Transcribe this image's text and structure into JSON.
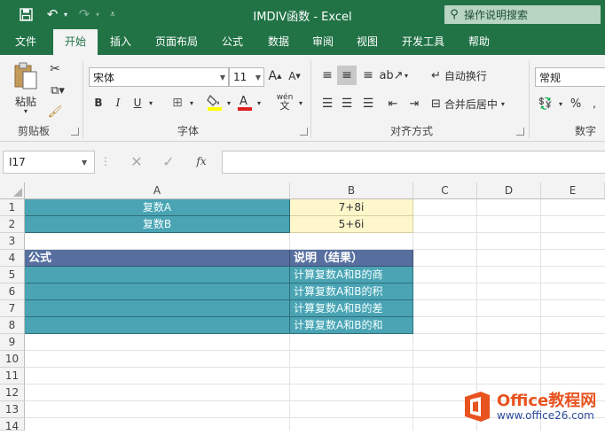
{
  "titlebar": {
    "title": "IMDIV函数  -  Excel",
    "tell_me": "操作说明搜索"
  },
  "tabs": [
    {
      "label": "文件"
    },
    {
      "label": "开始"
    },
    {
      "label": "插入"
    },
    {
      "label": "页面布局"
    },
    {
      "label": "公式"
    },
    {
      "label": "数据"
    },
    {
      "label": "审阅"
    },
    {
      "label": "视图"
    },
    {
      "label": "开发工具"
    },
    {
      "label": "帮助"
    }
  ],
  "ribbon": {
    "paste_label": "粘贴",
    "clipboard_group": "剪贴板",
    "font_name": "宋体",
    "font_size": "11",
    "font_group": "字体",
    "bold": "B",
    "italic": "I",
    "underline": "U",
    "wen": "wén",
    "wrap_text": "自动换行",
    "merge_center": "合并后居中",
    "align_group": "对齐方式",
    "number_format": "常规",
    "percent": "%",
    "number_group": "数字"
  },
  "formulabar": {
    "cell_ref": "I17",
    "fx": "fx",
    "content": ""
  },
  "grid": {
    "columns": [
      "A",
      "B",
      "C",
      "D",
      "E"
    ],
    "rows": [
      "1",
      "2",
      "3",
      "4",
      "5",
      "6",
      "7",
      "8",
      "9",
      "10",
      "11",
      "12",
      "13",
      "14"
    ],
    "A1": "复数A",
    "B1": "7+8i",
    "A2": "复数B",
    "B2": "5+6i",
    "A4": "公式",
    "B4": "说明（结果）",
    "B5": "计算复数A和B的商",
    "B6": "计算复数A和B的积",
    "B7": "计算复数A和B的差",
    "B8": "计算复数A和B的和"
  },
  "watermark": {
    "brand": "Office教程网",
    "url": "www.office26.com"
  },
  "colors": {
    "excel_green": "#217346",
    "teal_cell": "#4aa4b4",
    "header_blue": "#566f9f",
    "yellow_cell": "#fff7cc",
    "logo_orange": "#e8531f"
  }
}
